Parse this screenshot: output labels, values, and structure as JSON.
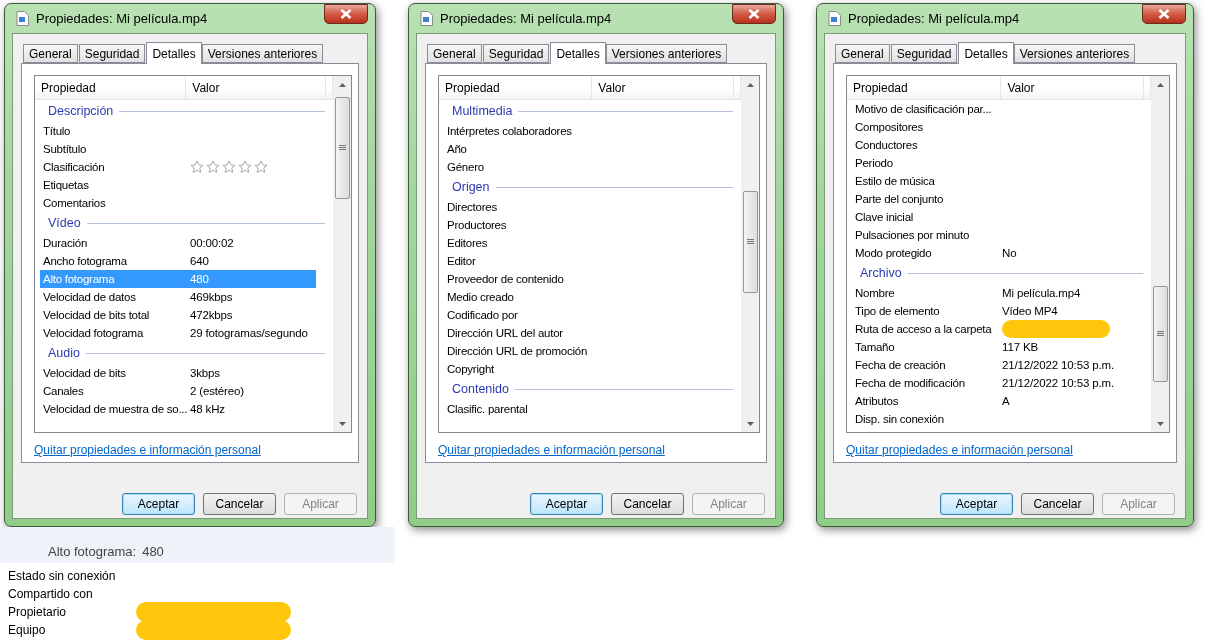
{
  "dialogs": [
    {
      "title": "Propiedades: Mi película.mp4",
      "tabs": [
        {
          "label": "General",
          "selected": false
        },
        {
          "label": "Seguridad",
          "selected": false
        },
        {
          "label": "Detalles",
          "selected": true
        },
        {
          "label": "Versiones anteriores",
          "selected": false
        }
      ],
      "columns": [
        "Propiedad",
        "Valor"
      ],
      "rows": [
        {
          "kind": "group",
          "label": "Descripción"
        },
        {
          "kind": "prop",
          "name": "Título",
          "selected": false
        },
        {
          "kind": "prop",
          "name": "Subtítulo",
          "selected": false
        },
        {
          "kind": "stars",
          "name": "Clasificación",
          "stars": 0,
          "selected": false
        },
        {
          "kind": "prop",
          "name": "Etiquetas",
          "selected": false
        },
        {
          "kind": "prop",
          "name": "Comentarios",
          "selected": false
        },
        {
          "kind": "group",
          "label": "Vídeo"
        },
        {
          "kind": "prop",
          "name": "Duración",
          "value": "00:00:02",
          "selected": false
        },
        {
          "kind": "prop",
          "name": "Ancho fotograma",
          "value": "640",
          "selected": false
        },
        {
          "kind": "prop",
          "name": "Alto fotograma",
          "value": "480",
          "selected": true
        },
        {
          "kind": "prop",
          "name": "Velocidad de datos",
          "value": "469kbps",
          "selected": false
        },
        {
          "kind": "prop",
          "name": "Velocidad de bits total",
          "value": "472kbps",
          "selected": false
        },
        {
          "kind": "prop",
          "name": "Velocidad fotograma",
          "value": "29 fotogramas/segundo",
          "selected": false
        },
        {
          "kind": "group",
          "label": "Audio"
        },
        {
          "kind": "prop",
          "name": "Velocidad de bits",
          "value": "3kbps",
          "selected": false
        },
        {
          "kind": "prop",
          "name": "Canales",
          "value": "2 (estéreo)",
          "selected": false
        },
        {
          "kind": "prop",
          "name": "Velocidad de muestra de so...",
          "value": "48 kHz",
          "selected": false
        }
      ],
      "link": "Quitar propiedades e información personal",
      "buttons": [
        {
          "label": "Aceptar",
          "default": true,
          "disabled": false
        },
        {
          "label": "Cancelar",
          "default": false,
          "disabled": false
        },
        {
          "label": "Aplicar",
          "default": false,
          "disabled": true
        }
      ]
    },
    {
      "title": "Propiedades: Mi película.mp4",
      "tabs": [
        {
          "label": "General",
          "selected": false
        },
        {
          "label": "Seguridad",
          "selected": false
        },
        {
          "label": "Detalles",
          "selected": true
        },
        {
          "label": "Versiones anteriores",
          "selected": false
        }
      ],
      "columns": [
        "Propiedad",
        "Valor"
      ],
      "rows": [
        {
          "kind": "group",
          "label": "Multimedia"
        },
        {
          "kind": "prop",
          "name": "Intérpretes colaboradores",
          "selected": false
        },
        {
          "kind": "prop",
          "name": "Año",
          "selected": false
        },
        {
          "kind": "prop",
          "name": "Género",
          "selected": false
        },
        {
          "kind": "group",
          "label": "Origen"
        },
        {
          "kind": "prop",
          "name": "Directores",
          "selected": false
        },
        {
          "kind": "prop",
          "name": "Productores",
          "selected": false
        },
        {
          "kind": "prop",
          "name": "Editores",
          "selected": false
        },
        {
          "kind": "prop",
          "name": "Editor",
          "selected": false
        },
        {
          "kind": "prop",
          "name": "Proveedor de contenido",
          "selected": false
        },
        {
          "kind": "prop",
          "name": "Medio creado",
          "selected": false
        },
        {
          "kind": "prop",
          "name": "Codificado por",
          "selected": false
        },
        {
          "kind": "prop",
          "name": "Dirección URL del autor",
          "selected": false
        },
        {
          "kind": "prop",
          "name": "Dirección URL de promoción",
          "selected": false
        },
        {
          "kind": "prop",
          "name": "Copyright",
          "selected": false
        },
        {
          "kind": "group",
          "label": "Contenido"
        },
        {
          "kind": "prop",
          "name": "Clasific. parental",
          "selected": false
        }
      ],
      "link": "Quitar propiedades e información personal",
      "buttons": [
        {
          "label": "Aceptar",
          "default": true,
          "disabled": false
        },
        {
          "label": "Cancelar",
          "default": false,
          "disabled": false
        },
        {
          "label": "Aplicar",
          "default": false,
          "disabled": true
        }
      ]
    },
    {
      "title": "Propiedades: Mi película.mp4",
      "tabs": [
        {
          "label": "General",
          "selected": false
        },
        {
          "label": "Seguridad",
          "selected": false
        },
        {
          "label": "Detalles",
          "selected": true
        },
        {
          "label": "Versiones anteriores",
          "selected": false
        }
      ],
      "columns": [
        "Propiedad",
        "Valor"
      ],
      "rows": [
        {
          "kind": "prop",
          "name": "Motivo de clasificación par...",
          "selected": false
        },
        {
          "kind": "prop",
          "name": "Compositores",
          "selected": false
        },
        {
          "kind": "prop",
          "name": "Conductores",
          "selected": false
        },
        {
          "kind": "prop",
          "name": "Periodo",
          "selected": false
        },
        {
          "kind": "prop",
          "name": "Estilo de música",
          "selected": false
        },
        {
          "kind": "prop",
          "name": "Parte del conjunto",
          "selected": false
        },
        {
          "kind": "prop",
          "name": "Clave inicial",
          "selected": false
        },
        {
          "kind": "prop",
          "name": "Pulsaciones por minuto",
          "selected": false
        },
        {
          "kind": "prop",
          "name": "Modo protegido",
          "value": "No",
          "selected": false
        },
        {
          "kind": "group",
          "label": "Archivo"
        },
        {
          "kind": "prop",
          "name": "Nombre",
          "value": "Mi película.mp4",
          "selected": false
        },
        {
          "kind": "prop",
          "name": "Tipo de elemento",
          "value": "Vídeo MP4",
          "selected": false
        },
        {
          "kind": "prop",
          "name": "Ruta de acceso a la carpeta",
          "redacted": true,
          "selected": false
        },
        {
          "kind": "prop",
          "name": "Tamaño",
          "value": "117 KB",
          "selected": false
        },
        {
          "kind": "prop",
          "name": "Fecha de creación",
          "value": "21/12/2022 10:53 p.m.",
          "selected": false
        },
        {
          "kind": "prop",
          "name": "Fecha de modificación",
          "value": "21/12/2022 10:53 p.m.",
          "selected": false
        },
        {
          "kind": "prop",
          "name": "Atributos",
          "value": "A",
          "selected": false
        },
        {
          "kind": "prop",
          "name": "Disp. sin conexión",
          "selected": false
        }
      ],
      "link": "Quitar propiedades e información personal",
      "buttons": [
        {
          "label": "Aceptar",
          "default": true,
          "disabled": false
        },
        {
          "label": "Cancelar",
          "default": false,
          "disabled": false
        },
        {
          "label": "Aplicar",
          "default": false,
          "disabled": true
        }
      ]
    }
  ],
  "background_details": {
    "summary": [
      {
        "label": "Alto fotograma:",
        "value": "480"
      }
    ],
    "rows": [
      {
        "name": "Estado sin conexión",
        "redacted": false
      },
      {
        "name": "Compartido con",
        "redacted": false
      },
      {
        "name": "Propietario",
        "redacted": true
      },
      {
        "name": "Equipo",
        "redacted": true
      }
    ]
  }
}
